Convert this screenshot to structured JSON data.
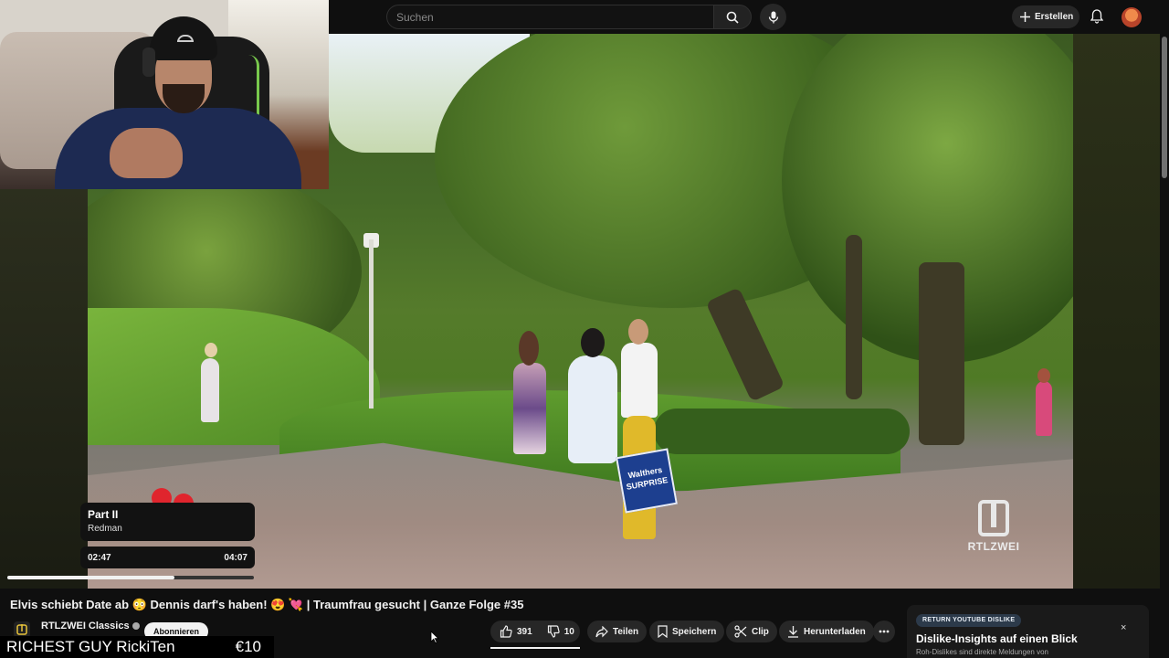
{
  "header": {
    "search_placeholder": "Suchen",
    "create_label": "Erstellen"
  },
  "now_playing": {
    "title": "Part II",
    "artist": "Redman",
    "elapsed": "02:47",
    "total": "04:07",
    "progress": 0.676
  },
  "video_overlay": {
    "bag_text": "Walthers SURPRISE",
    "logo_text": "RTLZWEI"
  },
  "video": {
    "title": "Elvis schiebt Date ab 😳 Dennis darf's haben! 😍 💘 | Traumfrau gesucht | Ganze Folge #35",
    "channel": "RTLZWEI Classics",
    "subscribe_label": "Abonnieren"
  },
  "actions": {
    "like_count": "391",
    "dislike_count": "10",
    "share_label": "Teilen",
    "save_label": "Speichern",
    "clip_label": "Clip",
    "download_label": "Herunterladen"
  },
  "ticker": {
    "name": "RICHEST GUY RickiTen",
    "amount": "€10"
  },
  "dislike_card": {
    "badge": "RETURN YOUTUBE DISLIKE",
    "title": "Dislike-Insights auf einen Blick",
    "subtitle": "Roh-Dislikes sind direkte Meldungen von",
    "close": "×"
  },
  "colors": {
    "background": "#0f0f0f",
    "pill": "#272727",
    "text": "#f1f1f1"
  }
}
